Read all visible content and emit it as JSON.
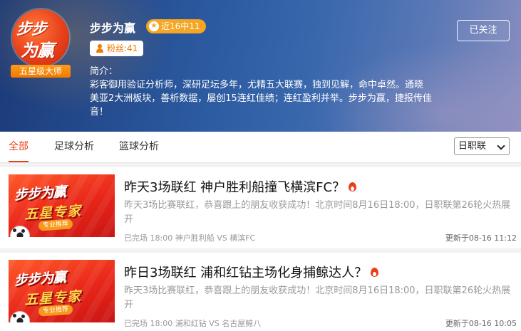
{
  "header": {
    "avatar": {
      "line1": "步步",
      "line2": "为赢",
      "ribbon": "五星级大师"
    },
    "name": "步步为赢",
    "record_badge": "近16中11",
    "fans": "粉丝:41",
    "intro_label": "简介：",
    "intro_text": "彩客御用验证分析师，深研足坛多年，尤精五大联赛，独到见解，命中卓然。通晓美亚2大洲板块，善析数据，屡创15连红佳绩；连红盈利并举。步步为赢，捷报传佳音！",
    "follow_button": "已关注"
  },
  "tabs": [
    {
      "label": "全部",
      "active": true
    },
    {
      "label": "足球分析",
      "active": false
    },
    {
      "label": "篮球分析",
      "active": false
    }
  ],
  "league_select": {
    "selected": "日职联"
  },
  "articles": [
    {
      "thumb": {
        "line1": "步步为赢",
        "line2": "五星专家",
        "ribbon": "专业推荐"
      },
      "title": "昨天3场联红 神户胜利船撞飞横滨FC？",
      "summary": "昨天3场比赛联红，恭喜跟上的朋友收获成功！北京时间8月16日18:00，日职联第26轮火热展开",
      "meta": "已完场 18:00 神户胜利船 VS 横滨FC",
      "updated": "更新于08-16 11:12"
    },
    {
      "thumb": {
        "line1": "步步为赢",
        "line2": "五星专家",
        "ribbon": "专业推荐"
      },
      "title": "昨日3场联红 浦和红钻主场化身捕鲸达人？",
      "summary": "昨天3场比赛联红，恭喜跟上的朋友收获成功！北京时间8月16日18:00，日职联第26轮火热展开",
      "meta": "已完场 18:00 浦和红钻 VS 名古屋鲸八",
      "updated": "更新于08-16 10:05"
    }
  ],
  "colors": {
    "accent": "#e8401a",
    "badge": "#f5a623",
    "header_blue": "#2c5aa0"
  }
}
